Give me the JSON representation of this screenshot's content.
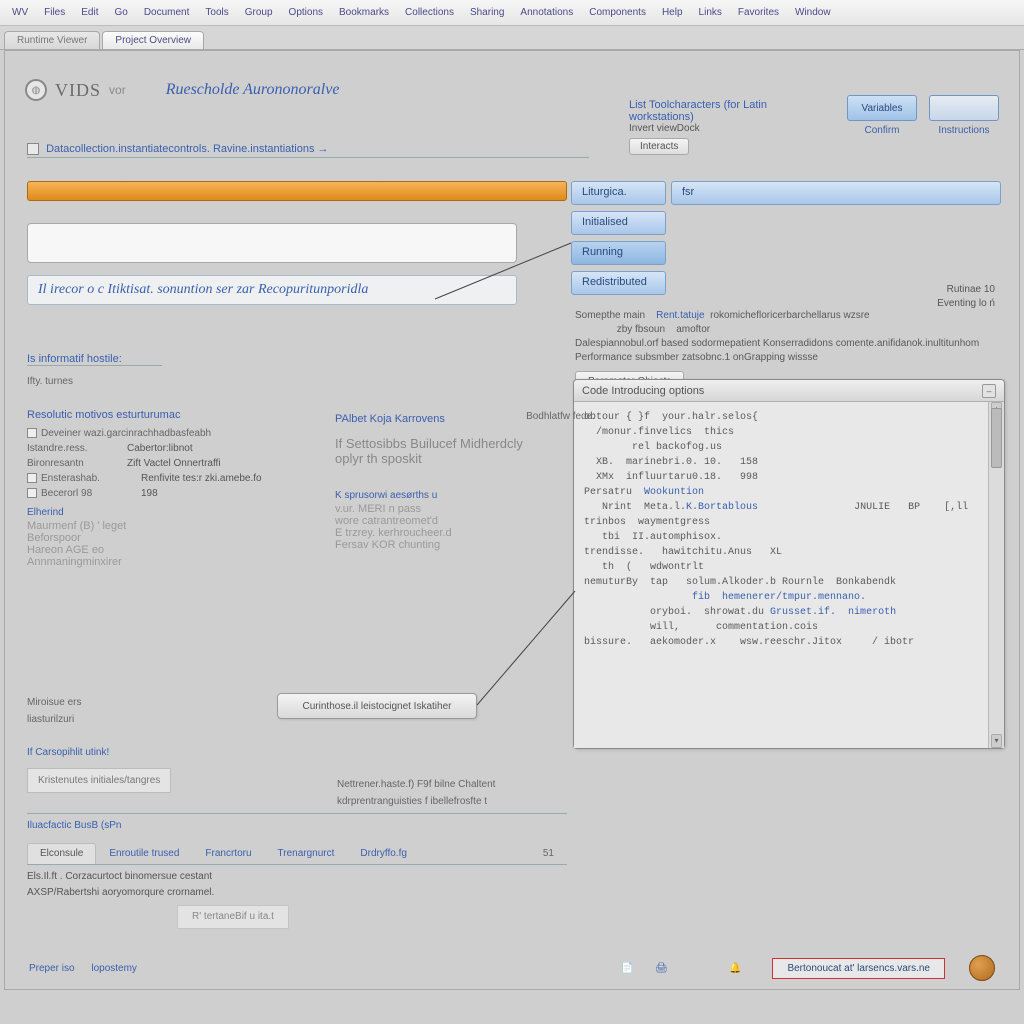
{
  "menubar": {
    "items": [
      "WV",
      "Files",
      "Edit",
      "Go",
      "Document",
      "Tools",
      "Group",
      "Options",
      "Bookmarks",
      "Collections",
      "Sharing",
      "Annotations",
      "Components",
      "Help",
      "Links",
      "Favorites",
      "Window"
    ]
  },
  "tabstrip": {
    "active": "Project Overview",
    "inactive": "Runtime Viewer"
  },
  "header": {
    "brand": "VIDS",
    "brand_sub": "vor",
    "title_accent": "Ruescholde  Aurononoralve"
  },
  "actionbar": {
    "btn1": "Variables",
    "btn2": "",
    "sub1": "Confirm",
    "sub2": "Instructions"
  },
  "infoblock": {
    "t": "List  Toolcharacters (for Latin workstations)",
    "line": "Invert viewDock",
    "btn": "Interacts"
  },
  "subheader": {
    "text": "Datacollection.instantiatecontrols.  Ravine.instantiations  →"
  },
  "orangebar_value": "",
  "captionbox": "Il irecor o c Itiktisat. sonuntion ser zar Recopuritunporidla",
  "blue_tabs": {
    "row1a": "Liturgica.",
    "row1a_value": "fsr",
    "row2": "Initialised",
    "row3": "Running",
    "row4": "Redistributed"
  },
  "right_meta": {
    "rt": "Rutinae  10",
    "rt2": "Eventing  lo ń",
    "l1a": "Somepthe main",
    "l1b_key": "Rent.tatuje",
    "l1b_val": "rokomichefloricerbarchellarus wzsre",
    "l2a": "zby  fbsoun",
    "l2b": "amoftor",
    "l3": "Dalespiannobul.orf based  sodormepatient  Konserradidons  comente.anifidanok.inultitunhom",
    "l4": "Performance subsmber  zatsobnc.1 onGrapping wissse",
    "btn": "Parameter Objects"
  },
  "console": {
    "title": "Code  Introducing options",
    "lines": [
      "obtour { }f  your.halr.selos{",
      "  /monur.finvelics  thics",
      "        rel backofog.us",
      "  XB.  marinebri.0. 10.   158",
      "  XMx  influurtaru0.18.   998",
      "Persatru  <span class='kw'>Wookuntion</span>",
      "   Nrint  Meta.l.<span class='kw'>K.Bortablous</span>                JNULIE   BP    [,ll trinbos  waymentgress",
      "   tbi  II.automphisox.                                             trendisse.   hawitchitu.Anus   XL",
      "   th  (   wdwontrlt",
      "nemuturBy  tap   solum.Alkoder.b Rournle  Bonkabendk",
      "                  <span class='kw'>fib  hemenerer/tmpur.mennano.</span>",
      "           oryboi.  shrowat.du <span class='kw'>Grusset.if.  nimeroth</span>",
      "           will,      commentation.cois",
      "bissure.   aekomoder.x    wsw.reeschr.Jitox     / ibotr"
    ]
  },
  "detail_left": {
    "section1": "Is informatif hostile:",
    "row_label": "Ifty.  turnes",
    "section2": "Resolutic motivos  esturturumac",
    "chk1": "Deveiner  wazi.garcinrachhadbasfeabh",
    "kv1_k": "Istandre.ress.",
    "kv1_v": "Cabertor:libnot",
    "kv2_k": "Bironresantn",
    "kv2_v": "Zift Vactel Onnertraffi",
    "chk2": "Ensterashab.",
    "chk2_v": "Renfivite tes:r zki.amebe.fo",
    "chk3": "Becerorl 98",
    "chk3_v": "198",
    "sub3": "Elherind",
    "g1": "Maurmenf  (B) ' leget",
    "g2": "Beforspoor",
    "g3": "Hareon AGE  eo",
    "g4": "Annmaningminxirer"
  },
  "detail_mid": {
    "section1": "PAlbet Koja  Karrovens",
    "big": "If Settosibbs  Builucef  Midherdcly",
    "big2": "oplyr  th sposkit",
    "sub": "K sprusorwi aesørths u",
    "g1": "v.ur.  MERI  n  pass",
    "g2": "wore  catrantreomet'd",
    "g3": "E trzrey.  kerhroucheer.d",
    "g4": "Fersav  KOR  chunting",
    "right_label": "Bodhlatfw fede."
  },
  "widebtn": "Curinthose.il leistocignet   Iskatiher",
  "lower": {
    "a1": "Miroisue ers",
    "a2": "liasturilzuri",
    "b_label": "If Carsopihlit utink!",
    "panel_line": "Kristenutes   initiales/tangres",
    "c1": "Nettrener.haste.f) F9f bilne Chaltent",
    "c2": "kdrprentranguisties  f ibellefrosfte t",
    "sep": "Iluacfactic BusB (sPn"
  },
  "bottom_tabs": [
    "Elconsule",
    "Enroutile trused",
    "Francrtoru",
    "Trenargnurct",
    "Drdryffo.fg"
  ],
  "bottom_tabs_right": "51",
  "bottom_info": {
    "l1": "Els.Il.ft . Corzacurtoct binomersue cestant",
    "l2": "AXSP/Rabertshi aoryomorqure  crornamel.",
    "btn": "R' tertaneBif  u   ita.t"
  },
  "footer": {
    "left1": "Preper  iso",
    "left2": "lopostemy",
    "redbox": "Bertonoucat at' larsencs.vars.ne"
  }
}
